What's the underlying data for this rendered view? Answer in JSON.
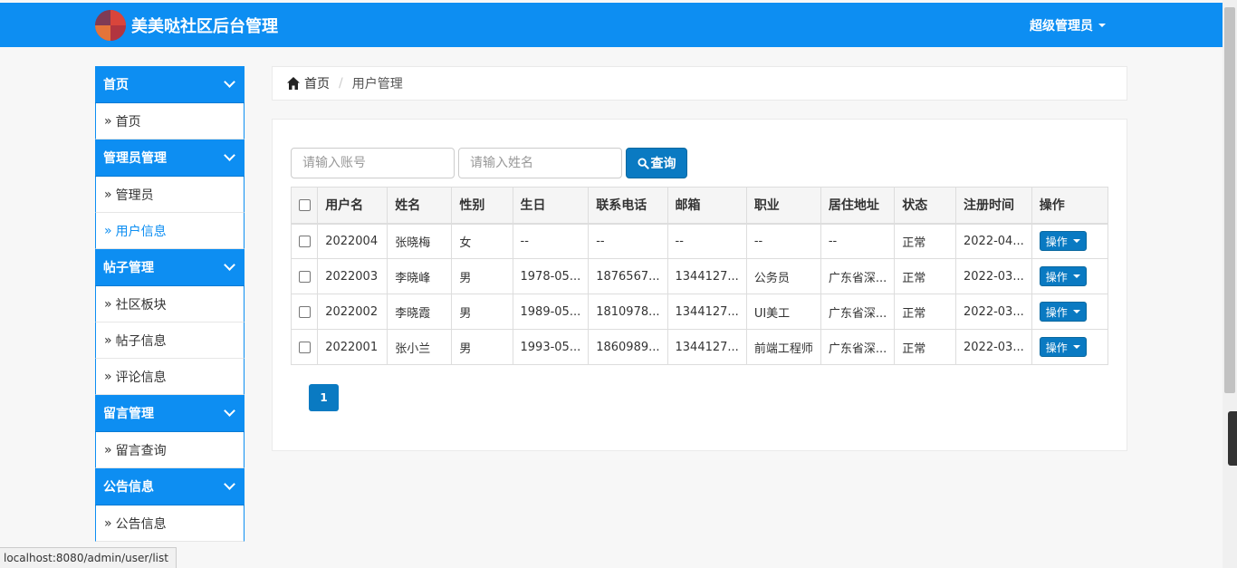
{
  "brand": {
    "title": "美美哒社区后台管理"
  },
  "user_menu": {
    "label": "超级管理员"
  },
  "sidebar": {
    "groups": [
      {
        "title": "首页",
        "items": [
          {
            "label": "首页"
          }
        ]
      },
      {
        "title": "管理员管理",
        "items": [
          {
            "label": "管理员"
          },
          {
            "label": "用户信息"
          }
        ]
      },
      {
        "title": "帖子管理",
        "items": [
          {
            "label": "社区板块"
          },
          {
            "label": "帖子信息"
          },
          {
            "label": "评论信息"
          }
        ]
      },
      {
        "title": "留言管理",
        "items": [
          {
            "label": "留言查询"
          }
        ]
      },
      {
        "title": "公告信息",
        "items": [
          {
            "label": "公告信息"
          }
        ]
      }
    ],
    "raquo": "»"
  },
  "breadcrumb": {
    "home": "首页",
    "separator": "/",
    "current": "用户管理"
  },
  "search": {
    "account_placeholder": "请输入账号",
    "name_placeholder": "请输入姓名",
    "button_label": "查询"
  },
  "table": {
    "headers": [
      "用户名",
      "姓名",
      "性别",
      "生日",
      "联系电话",
      "邮箱",
      "职业",
      "居住地址",
      "状态",
      "注册时间",
      "操作"
    ],
    "rows": [
      {
        "username": "2022004",
        "name": "张晓梅",
        "gender": "女",
        "birthday": "--",
        "phone": "--",
        "email": "--",
        "job": "--",
        "address": "--",
        "status": "正常",
        "reg_time": "2022-04...",
        "op": "操作"
      },
      {
        "username": "2022003",
        "name": "李晓峰",
        "gender": "男",
        "birthday": "1978-05...",
        "phone": "1876567...",
        "email": "1344127...",
        "job": "公务员",
        "address": "广东省深...",
        "status": "正常",
        "reg_time": "2022-03...",
        "op": "操作"
      },
      {
        "username": "2022002",
        "name": "李晓霞",
        "gender": "男",
        "birthday": "1989-05...",
        "phone": "1810978...",
        "email": "1344127...",
        "job": "UI美工",
        "address": "广东省深...",
        "status": "正常",
        "reg_time": "2022-03...",
        "op": "操作"
      },
      {
        "username": "2022001",
        "name": "张小兰",
        "gender": "男",
        "birthday": "1993-05...",
        "phone": "1860989...",
        "email": "1344127...",
        "job": "前端工程师",
        "address": "广东省深...",
        "status": "正常",
        "reg_time": "2022-03...",
        "op": "操作"
      }
    ]
  },
  "pagination": {
    "current": "1"
  },
  "status_bar": {
    "url": "localhost:8080/admin/user/list"
  },
  "colors": {
    "primary": "#0d8ef2",
    "button": "#0a7ac2",
    "active_link": "#0d8ef2"
  }
}
